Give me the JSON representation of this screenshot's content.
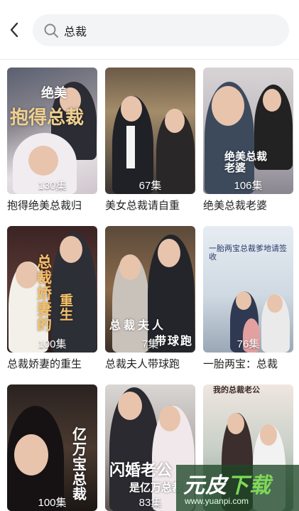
{
  "search": {
    "value": "总裁"
  },
  "cards": [
    {
      "title": "抱得绝美总裁归",
      "episodes": "130集",
      "poster_text": "抱得总裁",
      "poster_text2": "绝美"
    },
    {
      "title": "美女总裁请自重",
      "episodes": "67集",
      "poster_text": "",
      "poster_text2": ""
    },
    {
      "title": "绝美总裁老婆",
      "episodes": "106集",
      "poster_text": "绝美总裁老婆",
      "poster_text2": ""
    },
    {
      "title": "总裁娇妻的重生",
      "episodes": "100集",
      "poster_text": "总裁娇妻的",
      "poster_text2": "重生"
    },
    {
      "title": "总裁夫人带球跑",
      "episodes": "7集",
      "poster_text": "总裁夫人",
      "poster_text2": "带球跑"
    },
    {
      "title": "一胎两宝：总裁",
      "episodes": "76集",
      "poster_text": "一胎两宝总裁爹地请签收",
      "poster_text2": ""
    },
    {
      "title": "",
      "episodes": "100集",
      "poster_text": "亿万宝总裁",
      "poster_text2": ""
    },
    {
      "title": "",
      "episodes": "83集",
      "poster_text": "闪婚老公",
      "poster_text2": "是亿万总裁"
    },
    {
      "title": "",
      "episodes": "",
      "poster_text": "我的总裁老公",
      "poster_text2": ""
    }
  ],
  "watermark": {
    "text_a": "元皮",
    "text_b": "下载",
    "url": "www.yuanpi.com"
  }
}
